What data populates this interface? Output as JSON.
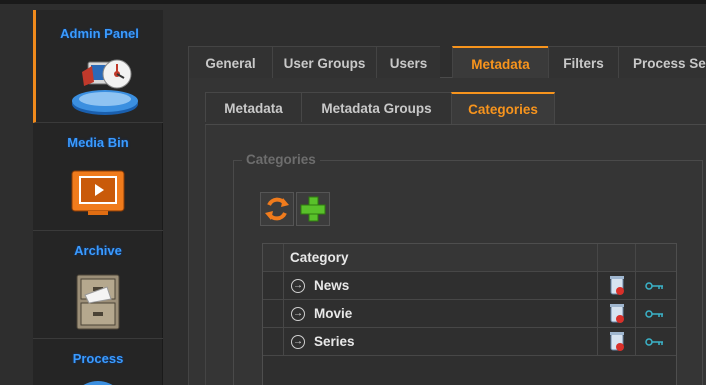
{
  "nav": {
    "items": [
      {
        "label": "Admin Panel",
        "icon": "admin-panel-icon",
        "active": true
      },
      {
        "label": "Media Bin",
        "icon": "media-bin-icon",
        "active": false
      },
      {
        "label": "Archive",
        "icon": "archive-cabinet-icon",
        "active": false
      },
      {
        "label": "Process",
        "icon": "process-icon",
        "active": false
      }
    ]
  },
  "main_tabs": [
    {
      "label": "General",
      "active": false
    },
    {
      "label": "User Groups",
      "active": false
    },
    {
      "label": "Users",
      "active": false
    },
    {
      "label": "Metadata",
      "active": true
    },
    {
      "label": "Filters",
      "active": false
    },
    {
      "label": "Process Se",
      "active": false
    }
  ],
  "sub_tabs": [
    {
      "label": "Metadata",
      "active": false
    },
    {
      "label": "Metadata Groups",
      "active": false
    },
    {
      "label": "Categories",
      "active": true
    }
  ],
  "categories_group": {
    "title": "Categories",
    "toolbar": {
      "refresh_icon": "refresh-icon",
      "add_icon": "add-icon"
    },
    "grid": {
      "header": "Category",
      "rows": [
        {
          "name": "News"
        },
        {
          "name": "Movie"
        },
        {
          "name": "Series"
        }
      ]
    }
  },
  "colors": {
    "accent": "#f7941d",
    "nav_label": "#3a9bff",
    "background": "#2e2e2e"
  }
}
